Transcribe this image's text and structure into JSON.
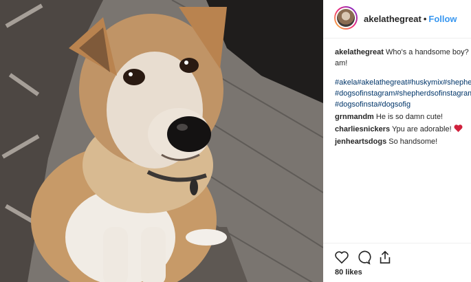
{
  "post": {
    "image_alt": "Photo of a tan and white husky shepherd mix dog sitting on a rug",
    "username": "akelathegreat",
    "follow_label": "Follow",
    "caption": {
      "user": "akelathegreat",
      "line1_text": "Who's a handsome boy? M",
      "line2_text": "am!",
      "hashtags_line1": "#akela#akelathegreat#huskymix#shepher",
      "hashtags_line2": "#dogsofinstagram#shepherdsofinstagram",
      "hashtags_line3": "#dogsofinsta#dogsofig"
    },
    "comments": [
      {
        "user": "grnmandm",
        "text": "He is so damn cute!"
      },
      {
        "user": "charliesnickers",
        "text": "Ypu are adorable!"
      },
      {
        "user": "jenheartsdogs",
        "text": "So handsome!"
      }
    ],
    "likes": "80 likes",
    "icons": [
      "heart-icon",
      "comment-icon",
      "share-icon"
    ],
    "colors": {
      "link": "#3897f0",
      "hashtag": "#003569",
      "heart_emoji": "#d0213d"
    }
  }
}
